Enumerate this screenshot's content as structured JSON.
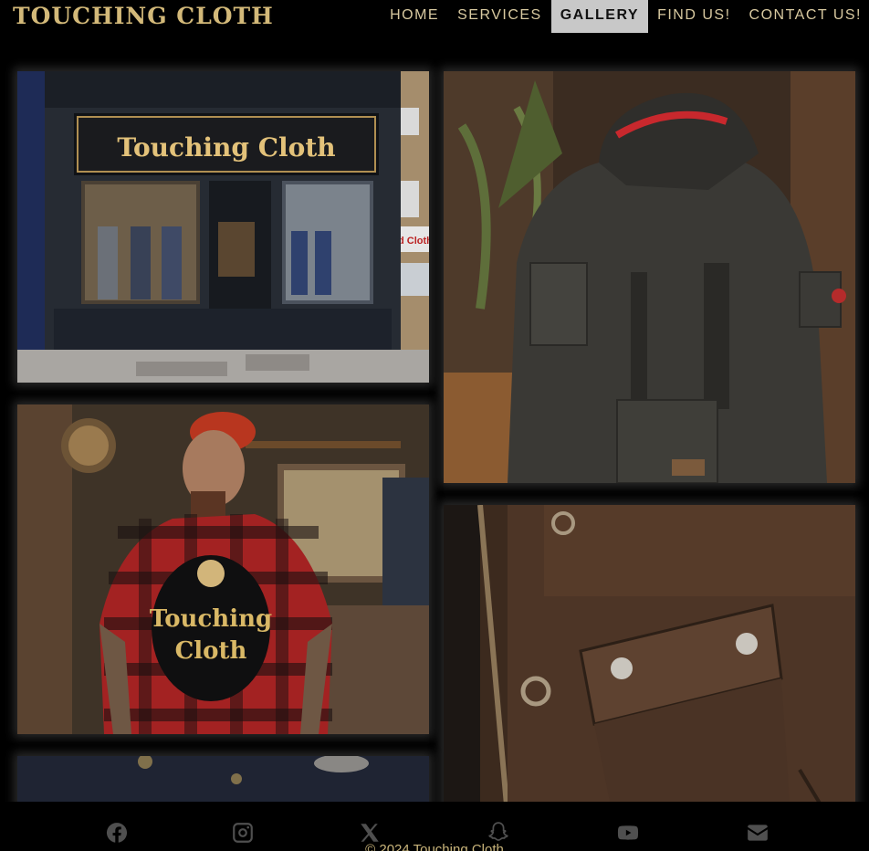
{
  "brand": {
    "title": "TOUCHING CLOTH"
  },
  "nav": {
    "items": [
      {
        "label": "HOME"
      },
      {
        "label": "SERVICES"
      },
      {
        "label": "GALLERY",
        "active": true
      },
      {
        "label": "FIND US!"
      },
      {
        "label": "CONTACT US!"
      }
    ]
  },
  "gallery": {
    "storefront_sign": "Touching Cloth",
    "storefront_side_sign": "d Cloth",
    "tshirt_print_line1": "Touching",
    "tshirt_print_line2": "Cloth"
  },
  "footer": {
    "social": [
      {
        "icon": "facebook-icon"
      },
      {
        "icon": "instagram-icon"
      },
      {
        "icon": "x-icon"
      },
      {
        "icon": "snapchat-icon"
      },
      {
        "icon": "youtube-icon"
      },
      {
        "icon": "envelope-icon"
      }
    ],
    "copyright": "© 2024 Touching Cloth"
  },
  "colors": {
    "accent": "#d3b979",
    "active_tab_bg": "#c8c8c8",
    "background": "#000000",
    "icon_gray": "#4f4f4f"
  }
}
